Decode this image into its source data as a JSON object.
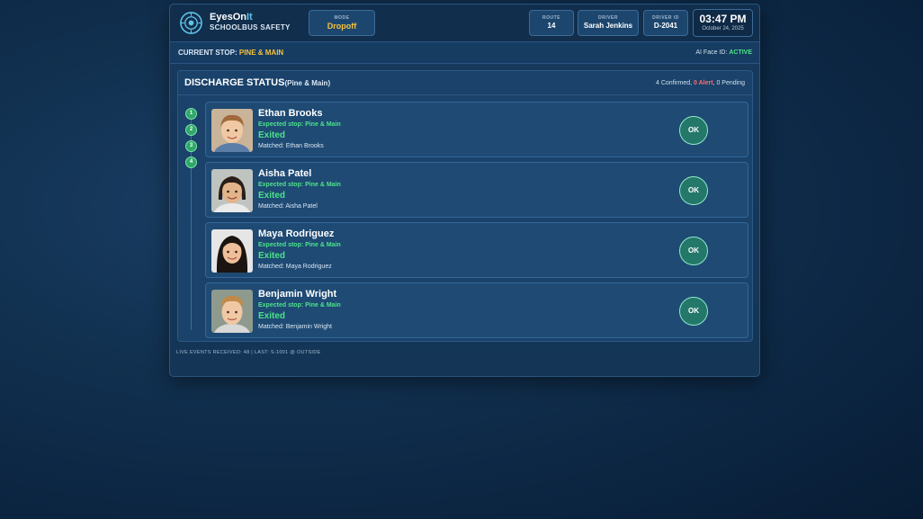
{
  "header": {
    "brand_name_a": "EyesOn",
    "brand_name_b": "It",
    "brand_sub": "SCHOOLBUS SAFETY",
    "mode_label": "MODE",
    "mode_value": "Dropoff",
    "route_label": "ROUTE",
    "route_value": "14",
    "driver_label": "DRIVER",
    "driver_value": "Sarah Jenkins",
    "driver_id_label": "DRIVER ID",
    "driver_id_value": "D-2041",
    "time": "03:47 PM",
    "date": "October 24, 2025"
  },
  "stopbar": {
    "label": "CURRENT STOP:",
    "value": "PINE & MAIN",
    "face_label": "AI Face ID:",
    "face_value": "ACTIVE"
  },
  "discharge": {
    "title": "DISCHARGE STATUS",
    "subtitle": "(Pine & Main)",
    "confirmed": "4 Confirmed,",
    "alert": "0 Alert",
    "pending": ", 0 Pending"
  },
  "timeline": [
    "1",
    "2",
    "3",
    "4"
  ],
  "students": [
    {
      "name": "Ethan Brooks",
      "expected": "Expected stop: Pine & Main",
      "status": "Exited",
      "matched": "Matched: Ethan Brooks",
      "action": "OK"
    },
    {
      "name": "Aisha Patel",
      "expected": "Expected stop: Pine & Main",
      "status": "Exited",
      "matched": "Matched: Aisha Patel",
      "action": "OK"
    },
    {
      "name": "Maya Rodriguez",
      "expected": "Expected stop: Pine & Main",
      "status": "Exited",
      "matched": "Matched: Maya Rodriguez",
      "action": "OK"
    },
    {
      "name": "Benjamin Wright",
      "expected": "Expected stop: Pine & Main",
      "status": "Exited",
      "matched": "Matched: Benjamin Wright",
      "action": "OK"
    }
  ],
  "footer": "LIVE EVENTS RECEIVED: 48 | LAST: S-1001 @ OUTSIDE",
  "colors": {
    "accent_yellow": "#f5c23d",
    "accent_green": "#4ee38a",
    "alert_red": "#ff6b6b",
    "panel_bg": "#173a5e"
  }
}
